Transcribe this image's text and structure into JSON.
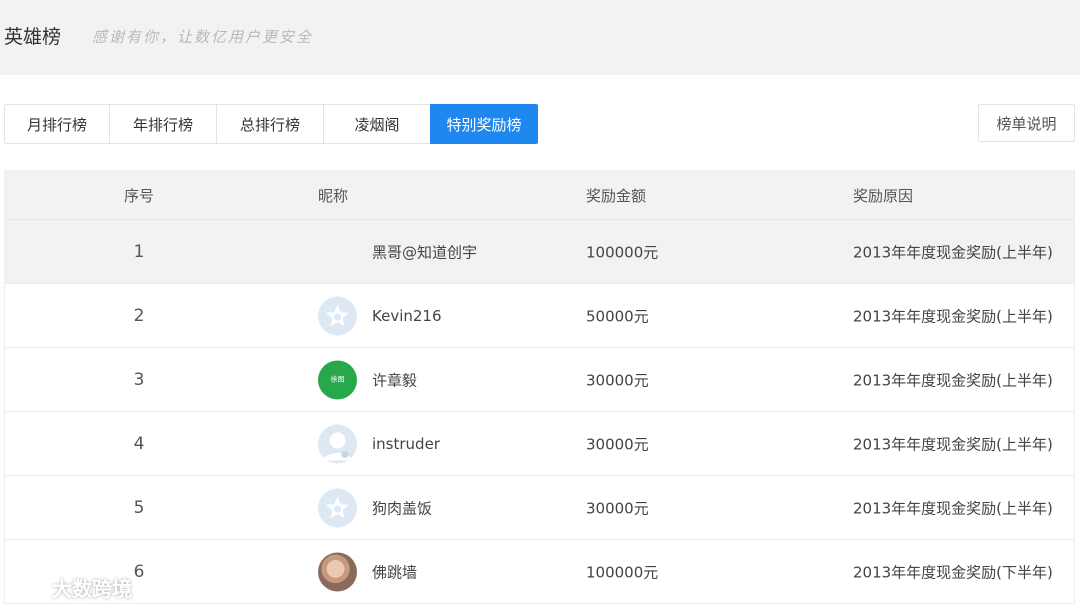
{
  "header": {
    "title": "英雄榜",
    "slogan": "感谢有你，让数亿用户更安全"
  },
  "tabs": [
    {
      "label": "月排行榜",
      "active": false
    },
    {
      "label": "年排行榜",
      "active": false
    },
    {
      "label": "总排行榜",
      "active": false
    },
    {
      "label": "凌烟阁",
      "active": false
    },
    {
      "label": "特别奖励榜",
      "active": true
    }
  ],
  "help_button": {
    "label": "榜单说明"
  },
  "table": {
    "headers": {
      "rank": "序号",
      "nickname": "昵称",
      "amount": "奖励金额",
      "reason": "奖励原因"
    },
    "rows": [
      {
        "rank": "1",
        "avatar": "none",
        "nickname": "黑哥@知道创宇",
        "amount": "100000元",
        "reason": "2013年年度现金奖励(上半年)"
      },
      {
        "rank": "2",
        "avatar": "star-avatar-icon",
        "nickname": "Kevin216",
        "amount": "50000元",
        "reason": "2013年年度现金奖励(上半年)"
      },
      {
        "rank": "3",
        "avatar": "green-logo-avatar",
        "avatar_text": "徐图",
        "nickname": "许章毅",
        "amount": "30000元",
        "reason": "2013年年度现金奖励(上半年)"
      },
      {
        "rank": "4",
        "avatar": "default-user-avatar-icon",
        "nickname": "instruder",
        "amount": "30000元",
        "reason": "2013年年度现金奖励(上半年)"
      },
      {
        "rank": "5",
        "avatar": "star-avatar-icon",
        "nickname": "狗肉盖饭",
        "amount": "30000元",
        "reason": "2013年年度现金奖励(上半年)"
      },
      {
        "rank": "6",
        "avatar": "photo-avatar",
        "nickname": "佛跳墙",
        "amount": "100000元",
        "reason": "2013年年度现金奖励(下半年)"
      }
    ]
  },
  "watermark": {
    "text": "大数跨境",
    "icon": "watermark-logo-icon"
  },
  "colors": {
    "accent": "#1e88f0",
    "header_bg": "#f2f2f2",
    "green_avatar": "#27a84a"
  }
}
